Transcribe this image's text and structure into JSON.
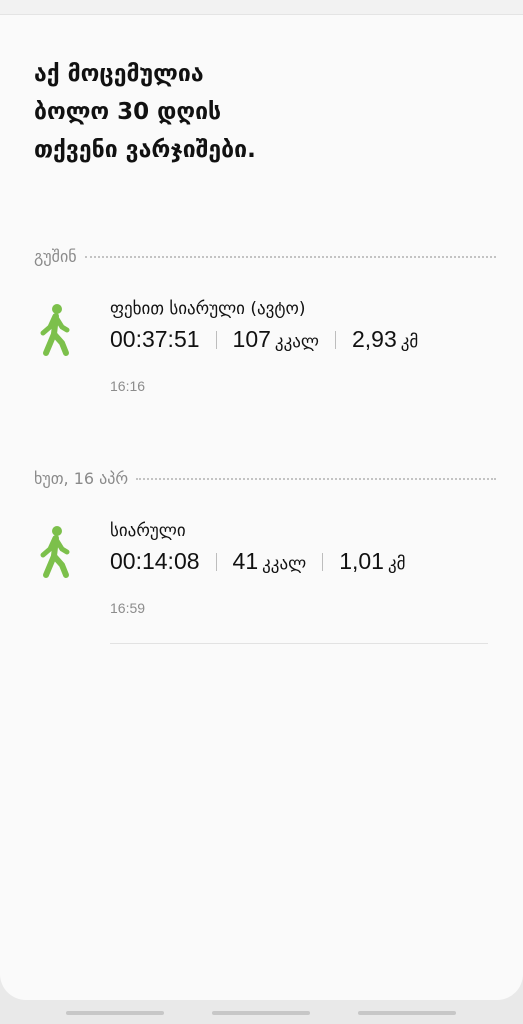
{
  "heading": {
    "line1": "აქ მოცემულია",
    "line2": "ბოლო 30 დღის",
    "line3": "თქვენი ვარჯიშები."
  },
  "sections": [
    {
      "label": "გუშინ",
      "activity": {
        "icon": "walking-person-icon",
        "title": "ფეხით სიარული (ავტო)",
        "duration": "00:37:51",
        "calories_value": "107",
        "calories_unit": "კკალ",
        "distance_value": "2,93",
        "distance_unit": "კმ",
        "time": "16:16"
      }
    },
    {
      "label": "ხუთ, 16 აპრ",
      "activity": {
        "icon": "walking-person-icon",
        "title": "სიარული",
        "duration": "00:14:08",
        "calories_value": "41",
        "calories_unit": "კკალ",
        "distance_value": "1,01",
        "distance_unit": "კმ",
        "time": "16:59"
      }
    }
  ],
  "colors": {
    "accent": "#7cc04b",
    "muted_text": "#8a8a8a",
    "card_background": "#fafafa"
  }
}
